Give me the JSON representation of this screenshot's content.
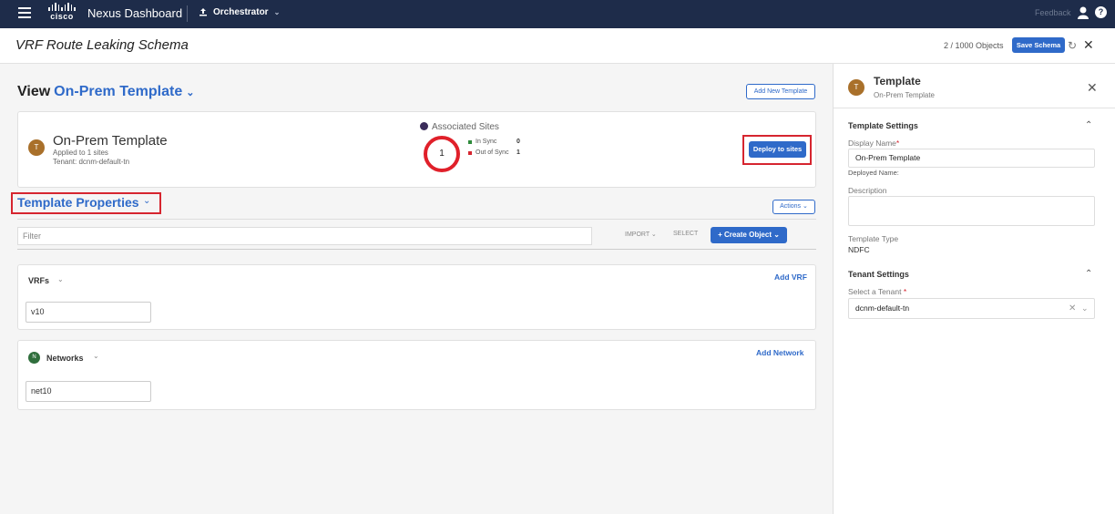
{
  "app": {
    "vendor": "cisco",
    "product": "Nexus Dashboard",
    "section": "Orchestrator",
    "feedback": "Feedback",
    "help": "?"
  },
  "schema": {
    "title": "VRF Route Leaking Schema",
    "object_count": "2 / 1000 Objects",
    "save_label": "Save Schema"
  },
  "view": {
    "prefix": "View",
    "template_name": "On-Prem Template",
    "add_template_label": "Add New Template"
  },
  "template_card": {
    "avatar": "T",
    "title": "On-Prem Template",
    "applied": "Applied to 1 sites",
    "tenant": "Tenant: dcnm-default-tn",
    "associated_label": "Associated Sites",
    "sites_total": "1",
    "in_sync_label": "In Sync",
    "in_sync_value": "0",
    "out_of_sync_label": "Out of Sync",
    "out_of_sync_value": "1",
    "deploy_label": "Deploy to sites"
  },
  "properties": {
    "title": "Template Properties",
    "actions_label": "Actions",
    "filter_placeholder": "Filter",
    "import_label": "IMPORT",
    "select_label": "SELECT",
    "create_label": "Create Object"
  },
  "vrfs": {
    "title": "VRFs",
    "add_label": "Add VRF",
    "items": [
      "v10"
    ]
  },
  "networks": {
    "badge": "N",
    "title": "Networks",
    "add_label": "Add Network",
    "items": [
      "net10"
    ]
  },
  "side_panel": {
    "avatar": "T",
    "title": "Template",
    "subtitle": "On-Prem Template",
    "template_settings_title": "Template Settings",
    "display_name_label": "Display Name",
    "display_name_value": "On-Prem Template",
    "deployed_name_label": "Deployed Name:",
    "description_label": "Description",
    "description_value": "",
    "template_type_label": "Template Type",
    "template_type_value": "NDFC",
    "tenant_settings_title": "Tenant Settings",
    "select_tenant_label": "Select a Tenant",
    "tenant_value": "dcnm-default-tn"
  },
  "colors": {
    "topbar": "#1e2c4a",
    "accent": "#2f6ac9",
    "highlight": "#d6252f",
    "in_sync": "#2e8b3b",
    "out_of_sync": "#d6252f"
  }
}
